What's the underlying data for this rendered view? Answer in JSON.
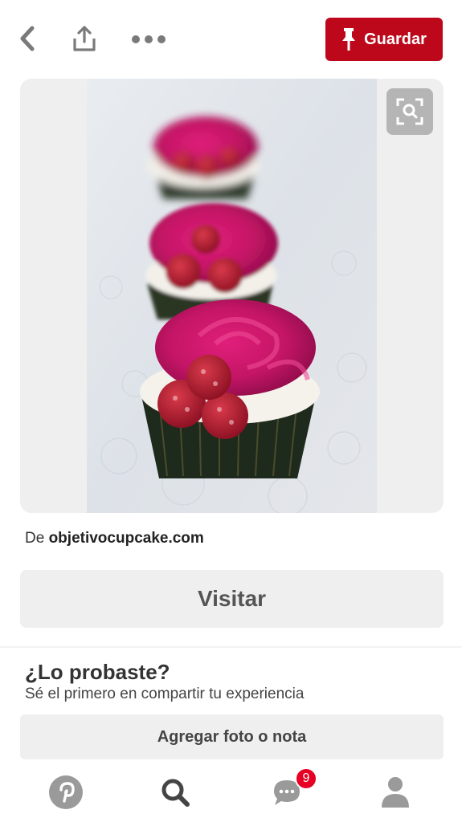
{
  "header": {
    "back_icon": "chevron-left-icon",
    "share_icon": "share-icon",
    "more_icon": "ellipsis-icon",
    "save_label": "Guardar",
    "save_icon": "pushpin-icon",
    "accent": "#bd081c"
  },
  "pin": {
    "image_icon": "cupcake-photo",
    "lens_icon": "visual-search-icon",
    "source_prefix": "De",
    "source_domain": "objetivocupcake.com"
  },
  "visit": {
    "label": "Visitar"
  },
  "tried": {
    "title": "¿Lo probaste?",
    "subtitle": "Sé el primero en compartir tu experiencia",
    "add_label": "Agregar foto o nota"
  },
  "nav": {
    "items": [
      {
        "icon": "pinterest-logo-icon"
      },
      {
        "icon": "search-icon"
      },
      {
        "icon": "chat-bubble-icon",
        "badge": "9"
      },
      {
        "icon": "profile-icon"
      }
    ],
    "badge_color": "#e60023"
  }
}
